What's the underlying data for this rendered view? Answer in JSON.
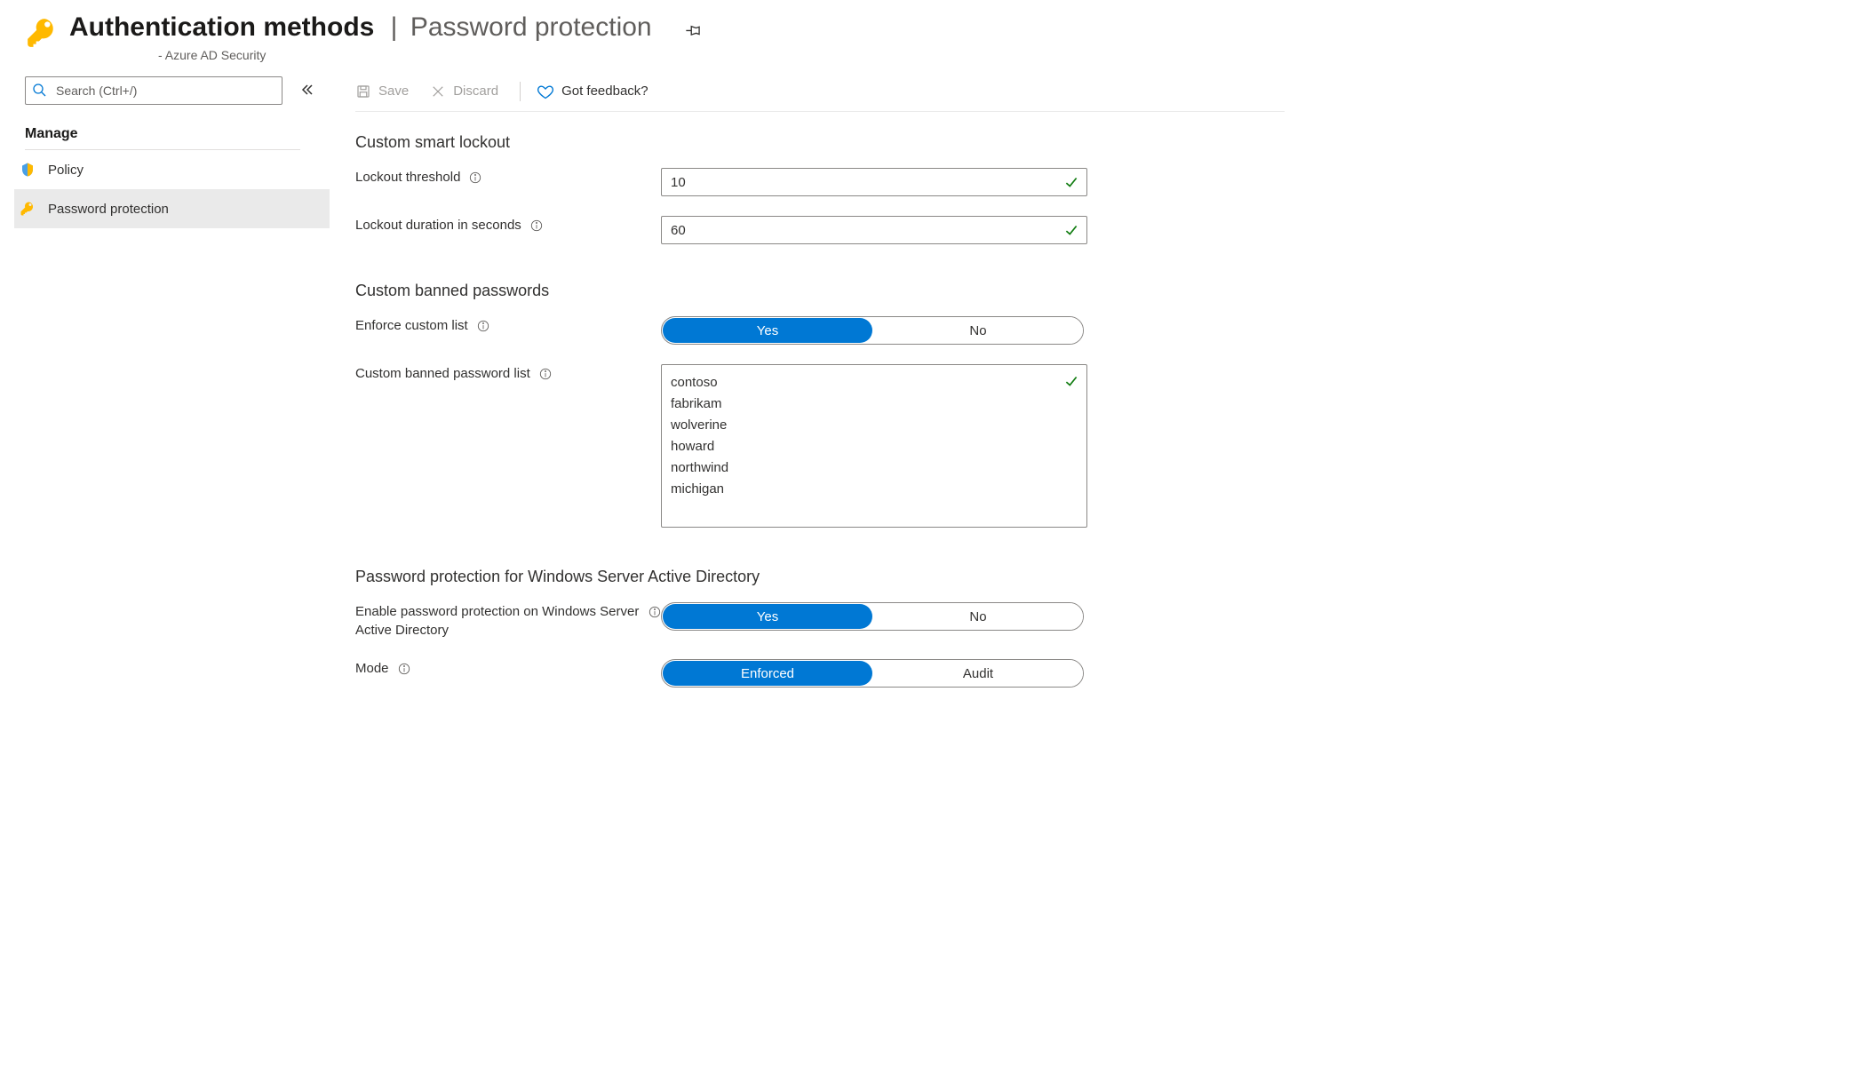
{
  "header": {
    "title_main": "Authentication methods",
    "title_sep": "|",
    "title_tail": "Password protection",
    "subtitle": "- Azure AD Security"
  },
  "sidebar": {
    "search_placeholder": "Search (Ctrl+/)",
    "manage_heading": "Manage",
    "items": [
      {
        "label": "Policy"
      },
      {
        "label": "Password protection"
      }
    ]
  },
  "toolbar": {
    "save_label": "Save",
    "discard_label": "Discard",
    "feedback_label": "Got feedback?"
  },
  "sections": {
    "smart_lockout_heading": "Custom smart lockout",
    "lockout_threshold_label": "Lockout threshold",
    "lockout_threshold_value": "10",
    "lockout_duration_label": "Lockout duration in seconds",
    "lockout_duration_value": "60",
    "banned_heading": "Custom banned passwords",
    "enforce_label": "Enforce custom list",
    "enforce_options": {
      "yes": "Yes",
      "no": "No"
    },
    "banned_list_label": "Custom banned password list",
    "banned_list_value": "contoso\nfabrikam\nwolverine\nhoward\nnorthwind\nmichigan",
    "wsad_heading": "Password protection for Windows Server Active Directory",
    "wsad_enable_label": "Enable password protection on Windows Server Active Directory",
    "wsad_enable_options": {
      "yes": "Yes",
      "no": "No"
    },
    "mode_label": "Mode",
    "mode_options": {
      "enforced": "Enforced",
      "audit": "Audit"
    }
  }
}
